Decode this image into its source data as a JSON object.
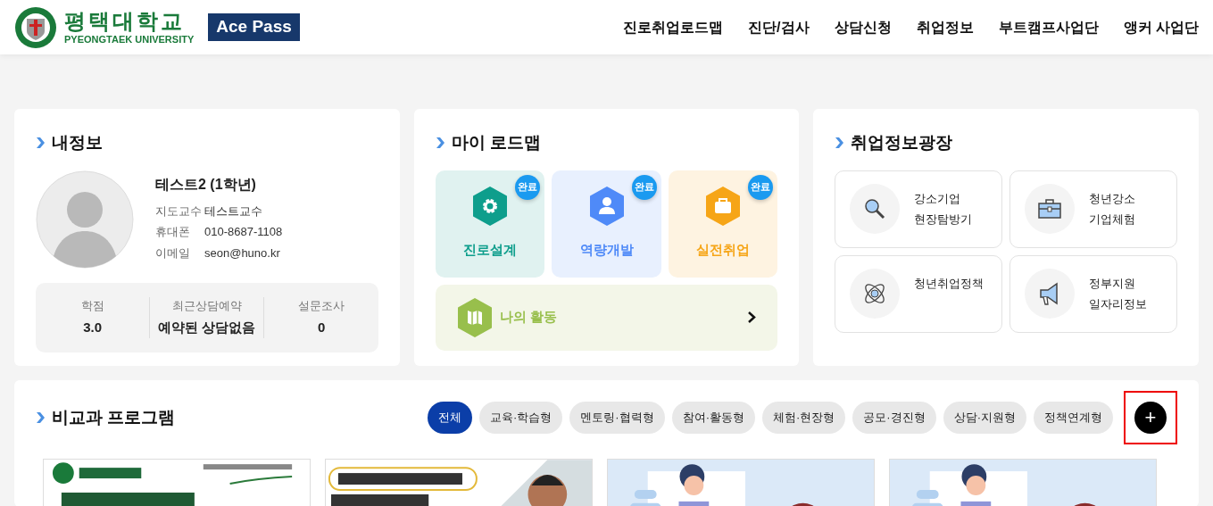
{
  "header": {
    "logo": {
      "name_ko": "평택대학교",
      "name_en": "PYEONGTAEK UNIVERSITY",
      "badge": "Ace Pass"
    },
    "nav": [
      {
        "label": "진로취업로드맵"
      },
      {
        "label": "진단/검사"
      },
      {
        "label": "상담신청"
      },
      {
        "label": "취업정보"
      },
      {
        "label": "부트캠프사업단"
      },
      {
        "label": "앵커 사업단"
      }
    ]
  },
  "my_info": {
    "title": "내정보",
    "name": "테스트2 (1학년)",
    "rows": [
      {
        "label": "지도교수",
        "value": "테스트교수"
      },
      {
        "label": "휴대폰",
        "value": "010-8687-1108"
      },
      {
        "label": "이메일",
        "value": "seon@huno.kr"
      }
    ],
    "stats": [
      {
        "label": "학점",
        "value": "3.0"
      },
      {
        "label": "최근상담예약",
        "value": "예약된 상담없음"
      },
      {
        "label": "설문조사",
        "value": "0"
      }
    ]
  },
  "roadmap": {
    "title": "마이 로드맵",
    "steps": [
      {
        "label": "진로설계",
        "badge": "완료",
        "kind": "gear",
        "color": "#0e9e8c"
      },
      {
        "label": "역량개발",
        "badge": "완료",
        "kind": "person",
        "color": "#4f8af8"
      },
      {
        "label": "실전취업",
        "badge": "완료",
        "kind": "briefcase",
        "color": "#f6a517"
      }
    ],
    "activity": {
      "label": "나의 활동",
      "color": "#98bf4c"
    }
  },
  "job_plaza": {
    "title": "취업정보광장",
    "items": [
      {
        "kind": "search",
        "lines": [
          "강소기업",
          "현장탐방기"
        ]
      },
      {
        "kind": "briefcase",
        "lines": [
          "청년강소",
          "기업체험"
        ]
      },
      {
        "kind": "atom",
        "lines": [
          "청년취업정책"
        ]
      },
      {
        "kind": "megaphone",
        "lines": [
          "정부지원",
          "일자리정보"
        ]
      }
    ]
  },
  "programs": {
    "title": "비교과 프로그램",
    "filters": [
      {
        "label": "전체",
        "selected": true
      },
      {
        "label": "교육·학습형",
        "selected": false
      },
      {
        "label": "멘토링·협력형",
        "selected": false
      },
      {
        "label": "참여·활동형",
        "selected": false
      },
      {
        "label": "체험·현장형",
        "selected": false
      },
      {
        "label": "공모·경진형",
        "selected": false
      },
      {
        "label": "상담·지원형",
        "selected": false
      },
      {
        "label": "정책연계형",
        "selected": false
      }
    ],
    "more_button": {
      "label": "+",
      "highlighted": true
    }
  }
}
